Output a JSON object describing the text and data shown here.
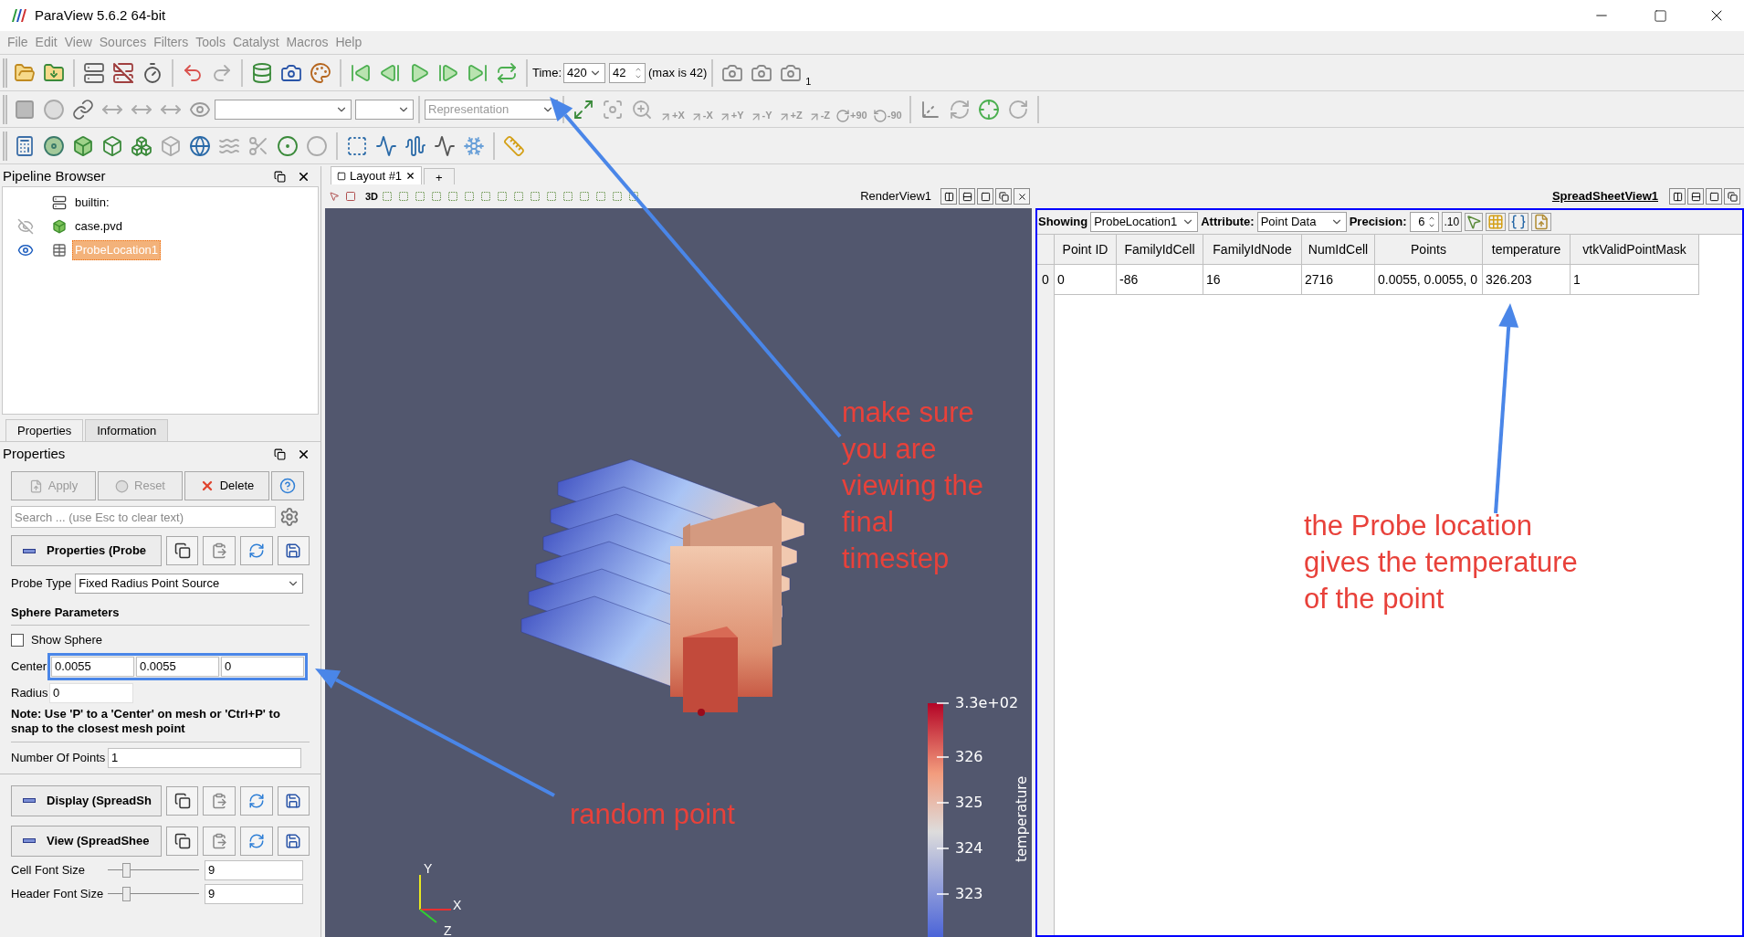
{
  "window": {
    "title": "ParaView 5.6.2 64-bit"
  },
  "menu": [
    "File",
    "Edit",
    "View",
    "Sources",
    "Filters",
    "Tools",
    "Catalyst",
    "Macros",
    "Help"
  ],
  "time_controls": {
    "label": "Time:",
    "time": "420",
    "timestep": "42",
    "max_note": "(max is 42)"
  },
  "camera_toolbar": {
    "count": "1"
  },
  "representation": {
    "value": "Representation",
    "disabled": true
  },
  "view_buttons": [
    "+X",
    "-X",
    "+Y",
    "-Y",
    "+Z",
    "-Z"
  ],
  "rotate_buttons": [
    "+90",
    "-90"
  ],
  "pipeline_browser": {
    "title": "Pipeline Browser",
    "items": [
      {
        "label": "builtin:",
        "kind": "server",
        "selected": false
      },
      {
        "label": "case.pvd",
        "kind": "source",
        "visible": false,
        "selected": false
      },
      {
        "label": "ProbeLocation1",
        "kind": "table",
        "visible": true,
        "selected": true
      }
    ]
  },
  "panel_tabs": [
    {
      "label": "Properties",
      "selected": true
    },
    {
      "label": "Information",
      "selected": false
    }
  ],
  "properties": {
    "title": "Properties",
    "actions": [
      {
        "label": "Apply",
        "kind": "apply",
        "disabled": true
      },
      {
        "label": "Reset",
        "kind": "reset",
        "disabled": true
      },
      {
        "label": "Delete",
        "kind": "delete",
        "disabled": false
      }
    ],
    "search_placeholder": "Search ... (use Esc to clear text)"
  },
  "properties_section": {
    "title": "Properties (Probe",
    "probe_type_label": "Probe Type",
    "probe_type": "Fixed Radius Point Source",
    "group_title": "Sphere Parameters",
    "show_sphere": {
      "label": "Show Sphere",
      "checked": false
    },
    "center_label": "Center",
    "center": [
      "0.0055",
      "0.0055",
      "0"
    ],
    "radius_label": "Radius",
    "radius": "0",
    "note": "Note: Use 'P' to a 'Center' on mesh or 'Ctrl+P' to snap to the closest mesh point",
    "points_label": "Number Of Points",
    "points": "1"
  },
  "display_section": {
    "title": "Display (SpreadSh"
  },
  "view_section": {
    "title": "View (SpreadShee",
    "sliders": [
      {
        "label": "Cell Font Size",
        "level": 0.2,
        "value": "9"
      },
      {
        "label": "Header Font Size",
        "level": 0.2,
        "value": "9"
      }
    ]
  },
  "layout_tabs": [
    {
      "label": "Layout #1",
      "selected": true
    }
  ],
  "new_tab": "+",
  "render_view": {
    "title": "RenderView1",
    "mode": "3D",
    "legend": {
      "title": "temperature",
      "ticks": [
        "3.3e+02",
        "326",
        "325",
        "324",
        "323"
      ]
    },
    "axes": [
      "Y",
      "X",
      "Z"
    ]
  },
  "spreadsheet": {
    "title": "SpreadSheetView1",
    "showing_label": "Showing",
    "showing": "ProbeLocation1",
    "attribute_label": "Attribute:",
    "attribute": "Point Data",
    "precision_label": "Precision:",
    "precision": "6",
    "fixed_label": ".10",
    "columns": [
      "Point ID",
      "FamilyIdCell",
      "FamilyIdNode",
      "NumIdCell",
      "Points",
      "temperature",
      "vtkValidPointMask"
    ],
    "rows": [
      {
        "index": "0",
        "cells": [
          "0",
          "-86",
          "16",
          "2716",
          "0.0055, 0.0055, 0",
          "326.203",
          "1"
        ]
      }
    ]
  },
  "annotations": [
    {
      "text": "make sure\nyou are\nviewing the\nfinal\ntimestep"
    },
    {
      "text": "the Probe location\ngives the temperature\nof the point"
    },
    {
      "text": "random point"
    }
  ]
}
